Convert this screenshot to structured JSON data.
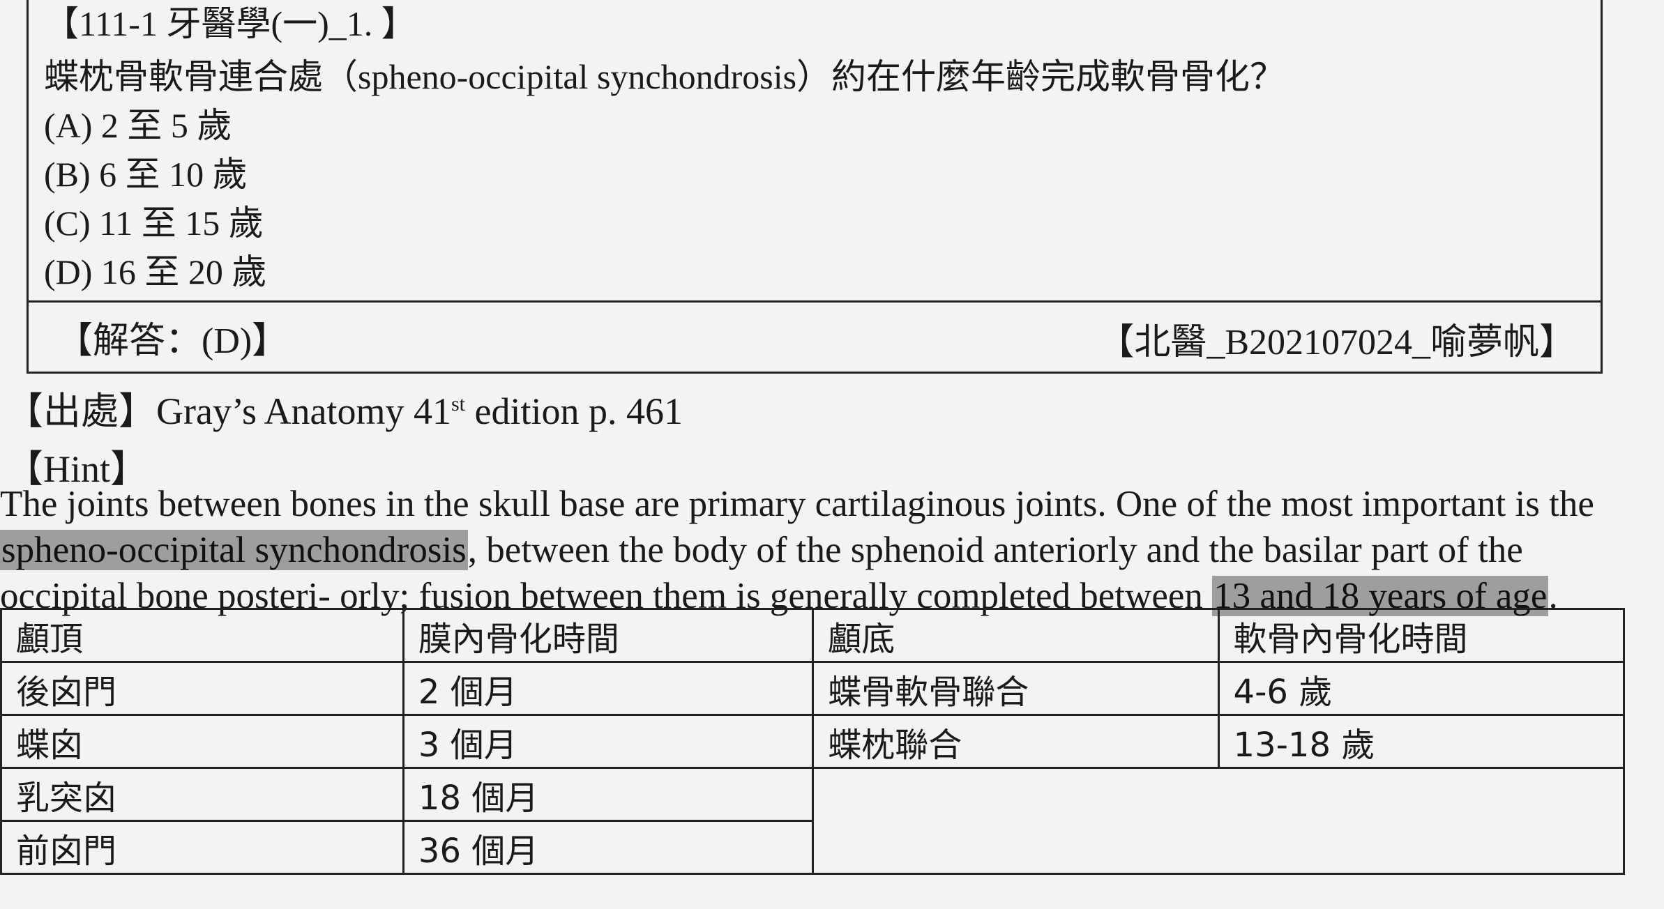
{
  "question": {
    "header": "【111-1 牙醫學(一)_1. 】",
    "text": "蝶枕骨軟骨連合處（spheno-occipital synchondrosis）約在什麼年齡完成軟骨骨化？",
    "options": [
      "(A) 2 至 5 歲",
      "(B) 6 至 10 歲",
      "(C) 11 至 15 歲",
      "(D) 16 至 20 歲"
    ],
    "answer": "【解答：(D)】",
    "author": "【北醫_B202107024_喻夢帆】"
  },
  "source": {
    "label": "【出處】",
    "text_pre": "Gray’s Anatomy 41",
    "sup": "st",
    "text_post": " edition p. 461"
  },
  "hint": {
    "heading": "【Hint】",
    "line1": "The joints between bones in the skull base are primary cartilaginous joints. One of the most important is the",
    "line2_hl": "spheno-occipital synchondrosis",
    "line2_rest": ", between the body of the sphenoid anteriorly and the basilar part of the",
    "line3_pre": "occipital bone posteri- orly; fusion between them is generally completed between ",
    "line3_hl": "13 and 18 years of age",
    "line3_post": "."
  },
  "table": {
    "headers": [
      "顱頂",
      "膜內骨化時間",
      "顱底",
      "軟骨內骨化時間"
    ],
    "rows": [
      [
        "後囟門",
        "2 個月",
        "蝶骨軟骨聯合",
        "4-6 歲"
      ],
      [
        "蝶囟",
        "3 個月",
        "蝶枕聯合",
        "13-18 歲"
      ],
      [
        "乳突囟",
        "18 個月",
        "",
        ""
      ],
      [
        "前囟門",
        "36 個月",
        "",
        ""
      ]
    ]
  }
}
